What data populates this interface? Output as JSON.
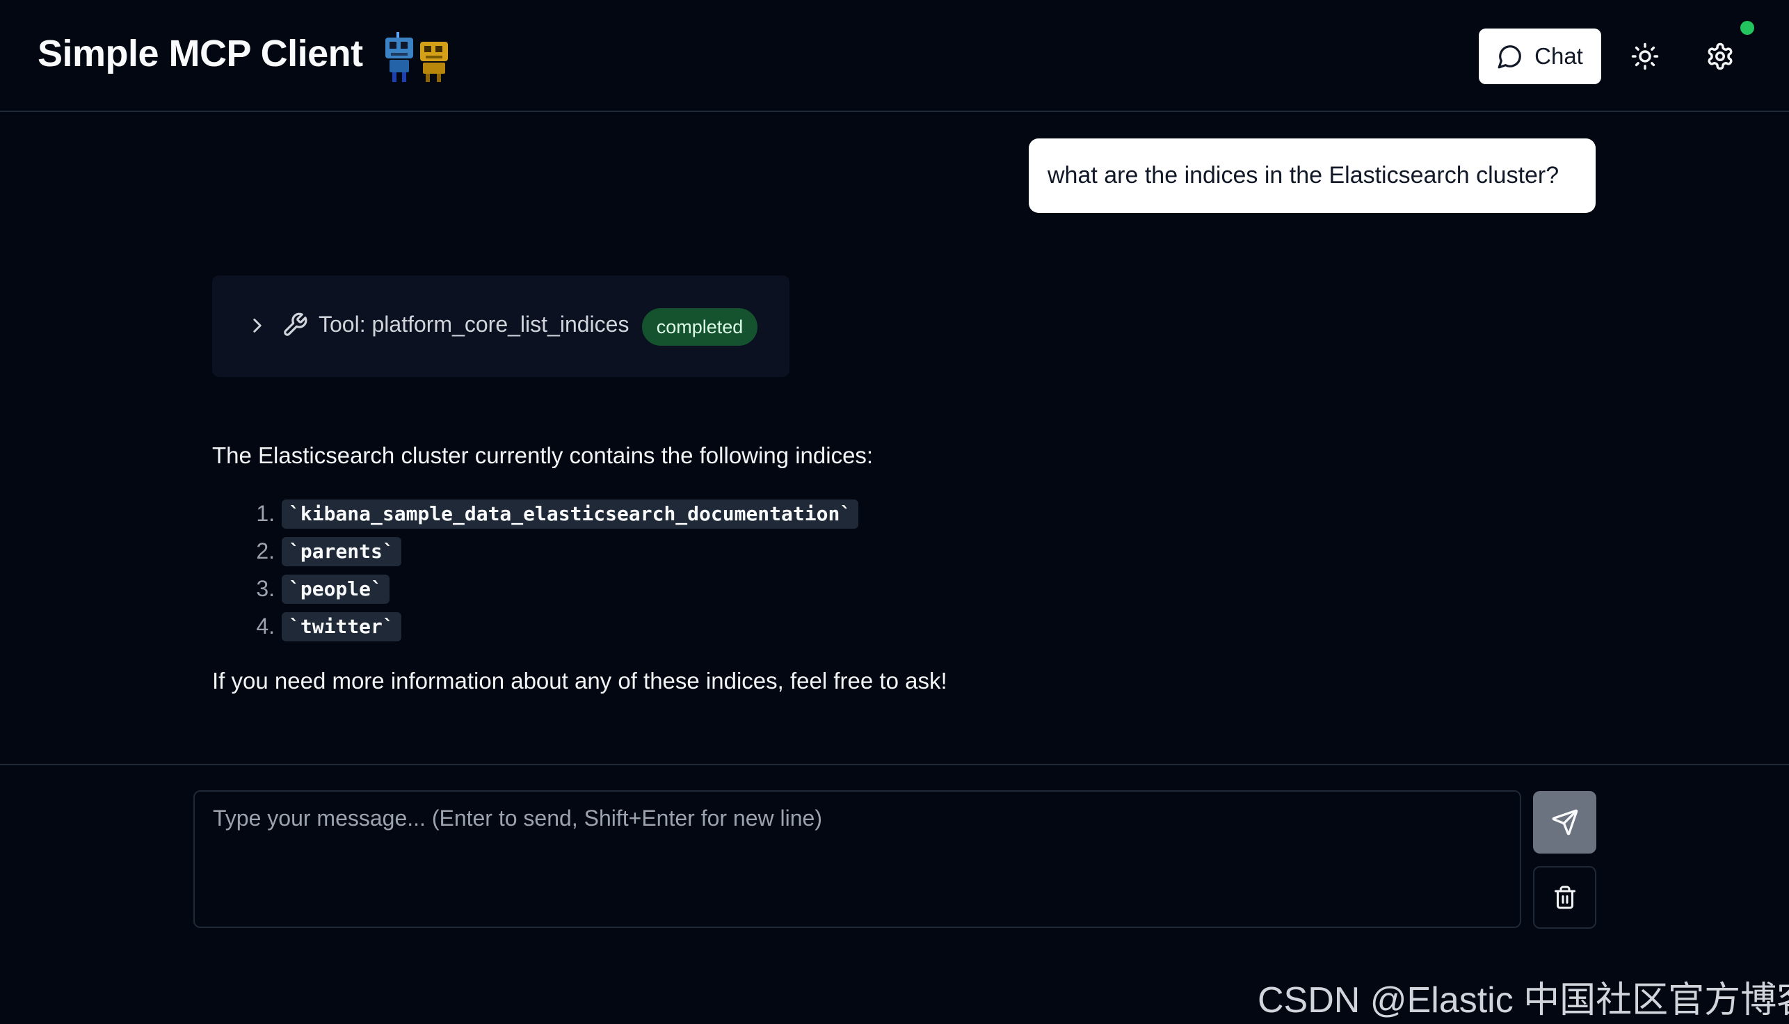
{
  "header": {
    "title": "Simple MCP Client",
    "chat_button_label": "Chat",
    "status_color": "#22c55e"
  },
  "messages": {
    "user_message": "what are the indices in the Elasticsearch cluster?",
    "tool_call": {
      "label": "Tool: platform_core_list_indices",
      "status": "completed"
    },
    "assistant": {
      "intro": "The Elasticsearch cluster currently contains the following indices:",
      "indices": [
        {
          "num": "1.",
          "name": "`kibana_sample_data_elasticsearch_documentation`"
        },
        {
          "num": "2.",
          "name": "`parents`"
        },
        {
          "num": "3.",
          "name": "`people`"
        },
        {
          "num": "4.",
          "name": "`twitter`"
        }
      ],
      "outro": "If you need more information about any of these indices, feel free to ask!"
    }
  },
  "composer": {
    "placeholder": "Type your message... (Enter to send, Shift+Enter for new line)",
    "value": ""
  },
  "watermark": "CSDN @Elastic 中国社区官方博客",
  "icons": {
    "chat_button": "message-circle-icon",
    "theme_toggle": "sun-icon",
    "settings": "gear-icon",
    "tool_expand": "chevron-right-icon",
    "tool": "wrench-icon",
    "send": "send-icon",
    "clear": "trash-icon",
    "logo": "robots-icon"
  }
}
